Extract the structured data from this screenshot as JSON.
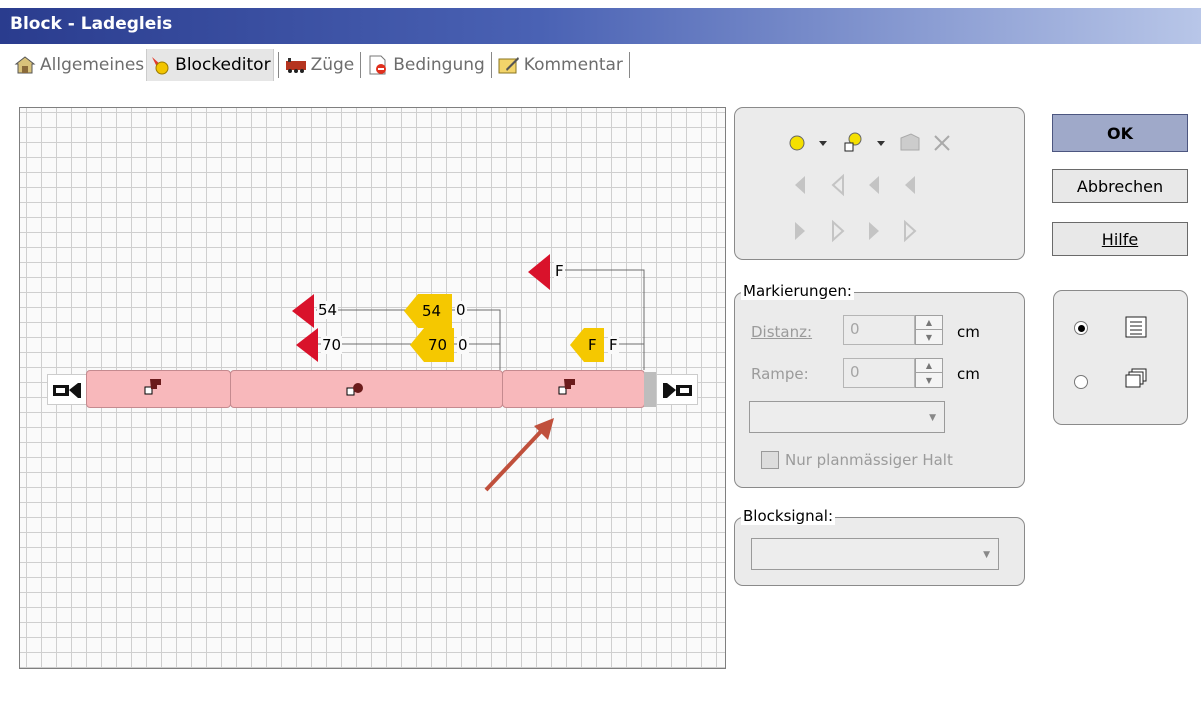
{
  "window": {
    "title": "Block - Ladegleis"
  },
  "tabs": [
    {
      "label": "Allgemeines",
      "icon": "general-icon",
      "active": false
    },
    {
      "label": "Blockeditor",
      "icon": "block-editor-icon",
      "active": true
    },
    {
      "label": "Züge",
      "icon": "train-icon",
      "active": false
    },
    {
      "label": "Bedingung",
      "icon": "condition-icon",
      "active": false
    },
    {
      "label": "Kommentar",
      "icon": "comment-icon",
      "active": false
    }
  ],
  "editor": {
    "labels": {
      "red_54": "54",
      "red_70": "70",
      "yellow_54": "54",
      "yellow_54_tail": "0",
      "yellow_70": "70",
      "yellow_70_tail": "0",
      "red_f": "F",
      "yellow_f": "F",
      "yellow_f_tail": "F"
    },
    "colors": {
      "block": "#f8b8bb",
      "red_marker": "#d9122b",
      "yellow_marker": "#f5c800",
      "arrow": "#c0503c"
    }
  },
  "tools_panel": {
    "icons": [
      "circle-marker-icon",
      "dropdown-icon",
      "object-icon",
      "dropdown-icon",
      "properties-icon",
      "delete-icon",
      "signal-left-icon",
      "signal-left-outline-icon",
      "signal-left-icon",
      "signal-left-icon",
      "signal-right-icon",
      "signal-right-icon",
      "signal-right-icon",
      "signal-right-icon"
    ]
  },
  "markings": {
    "legend": "Markierungen:",
    "distance_label": "Distanz:",
    "distance_value": "0",
    "ramp_label": "Rampe:",
    "ramp_value": "0",
    "unit": "cm",
    "stop_label": "Nur planmässiger Halt"
  },
  "block_signal": {
    "legend": "Blocksignal:"
  },
  "buttons": {
    "ok": "OK",
    "cancel": "Abbrechen",
    "help": "Hilfe"
  },
  "view": {
    "selected": "list"
  }
}
